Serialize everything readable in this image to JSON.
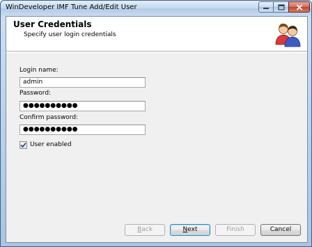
{
  "window": {
    "title": "WinDeveloper IMF Tune Add/Edit User"
  },
  "header": {
    "title": "User Credentials",
    "subtitle": "Specify user login credentials",
    "icon": "users-icon"
  },
  "form": {
    "login_name_label": "Login name:",
    "login_name_value": "admin",
    "password_label": "Password:",
    "password_value": "●●●●●●●●●●",
    "confirm_password_label": "Confirm password:",
    "confirm_password_value": "●●●●●●●●●●",
    "user_enabled_label": "User enabled",
    "user_enabled_checked": true
  },
  "buttons": {
    "back": {
      "mnemonic": "B",
      "rest": "ack",
      "enabled": false
    },
    "next": {
      "mnemonic": "N",
      "rest": "ext",
      "enabled": true
    },
    "finish": {
      "label": "Finish",
      "enabled": false
    },
    "cancel": {
      "label": "Cancel",
      "enabled": true
    }
  }
}
